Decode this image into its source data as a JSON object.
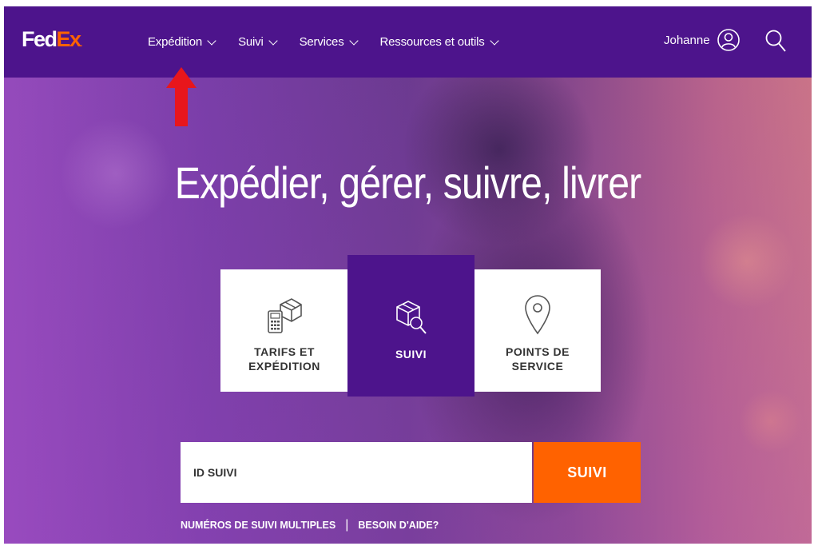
{
  "header": {
    "logo_fed": "Fed",
    "logo_ex": "Ex",
    "logo_dot": ".",
    "menu": [
      {
        "label": "Expédition"
      },
      {
        "label": "Suivi"
      },
      {
        "label": "Services"
      },
      {
        "label": "Ressources et outils"
      }
    ],
    "user_name": "Johanne"
  },
  "hero": {
    "headline": "Expédier, gérer, suivre, livrer",
    "cards": [
      {
        "label": "TARIFS ET\nEXPÉDITION",
        "icon": "rates-shipping-icon"
      },
      {
        "label": "SUIVI",
        "icon": "tracking-box-search-icon"
      },
      {
        "label": "POINTS DE\nSERVICE",
        "icon": "location-pin-icon"
      }
    ]
  },
  "tracking": {
    "placeholder": "ID SUIVI",
    "button_label": "SUIVI",
    "link_multiple": "NUMÉROS DE SUIVI MULTIPLES",
    "separator": "|",
    "link_help": "BESOIN D'AIDE?"
  },
  "colors": {
    "brand_purple": "#4d148c",
    "brand_orange": "#ff6200",
    "annotation_red": "#e8161c"
  }
}
